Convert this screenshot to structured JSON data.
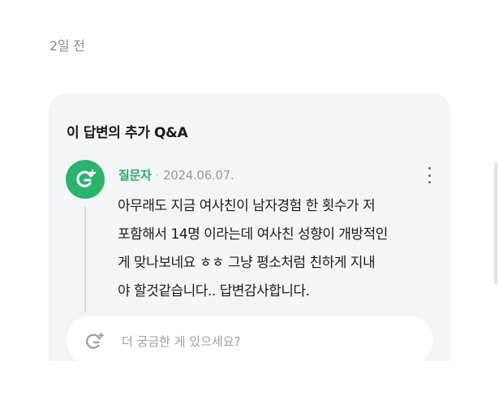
{
  "timestamp": "2일 전",
  "qa": {
    "title": "이 답변의 추가 Q&A",
    "asker": {
      "name": "질문자",
      "separator": "·",
      "date": "2024.06.07."
    },
    "question_lines": [
      "아무래도 지금 여사친이 남자경험 한 횟수가 저",
      "포함해서 14명 이라는데 여사친 성향이 개방적인",
      "게 맞나보네요 ㅎㅎ 그냥 평소처럼 친하게 지내",
      "야 할것같습니다.. 답변감사합니다."
    ],
    "input": {
      "placeholder": "더 궁금한 게 있으세요?",
      "value": ""
    }
  },
  "colors": {
    "accent_green": "#2cb36e",
    "card_bg": "#f4f5f7"
  },
  "icons": {
    "avatar": "question-plus-icon",
    "more": "vertical-dots-icon",
    "input": "question-plus-outline-icon"
  }
}
